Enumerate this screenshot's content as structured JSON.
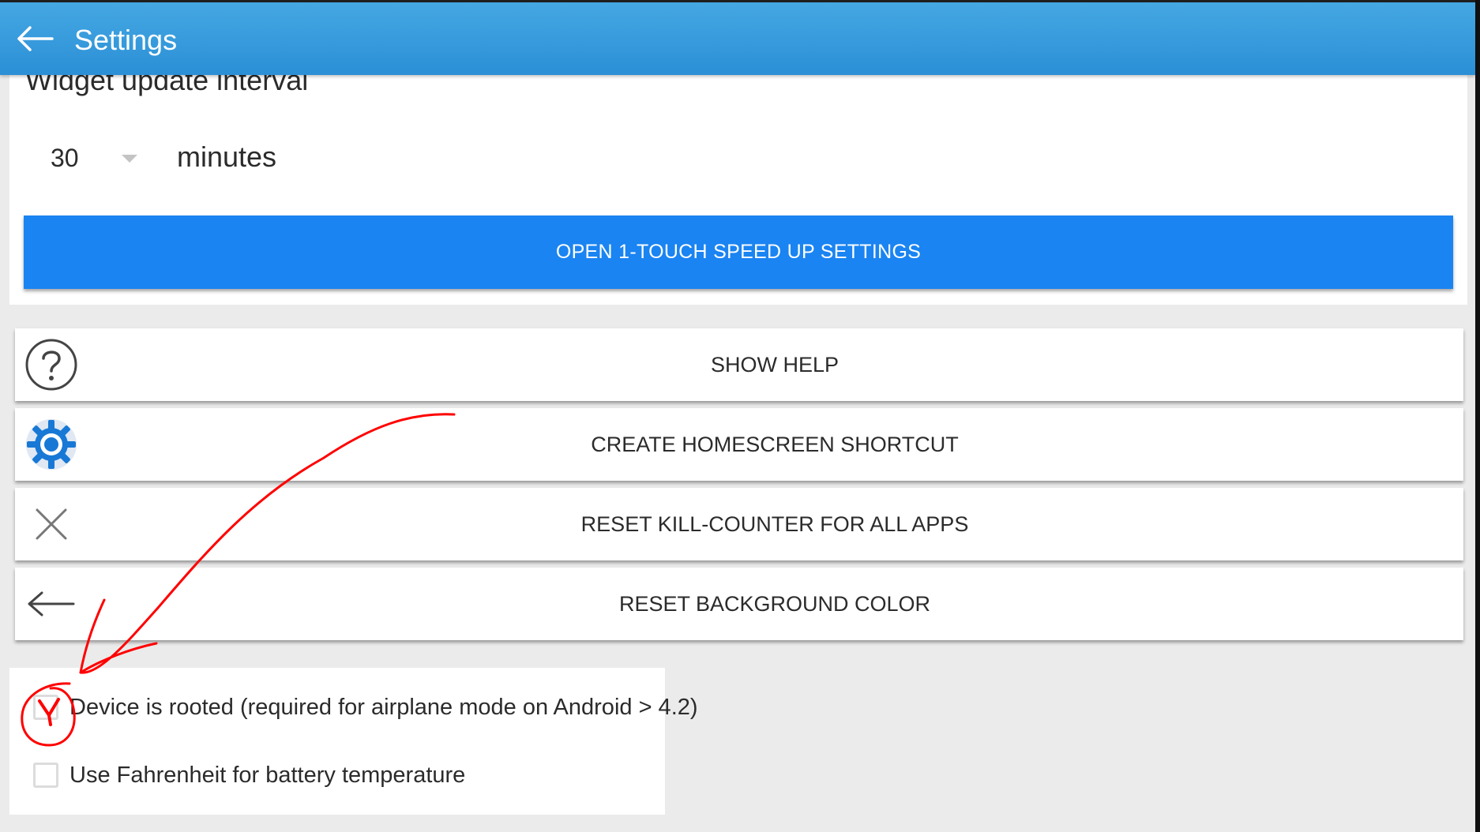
{
  "appbar": {
    "title": "Settings"
  },
  "widget": {
    "label": "Widget update interval",
    "interval_value": "30",
    "interval_unit": "minutes"
  },
  "primary_button": {
    "label": "OPEN 1-TOUCH SPEED UP SETTINGS"
  },
  "actions": [
    {
      "label": "SHOW HELP",
      "icon": "help-circle-icon"
    },
    {
      "label": "CREATE HOMESCREEN SHORTCUT",
      "icon": "gear-icon"
    },
    {
      "label": "RESET KILL-COUNTER FOR ALL APPS",
      "icon": "close-icon"
    },
    {
      "label": "RESET BACKGROUND COLOR",
      "icon": "arrow-left-icon"
    }
  ],
  "checkboxes": [
    {
      "label": "Device is rooted (required for airplane mode on Android > 4.2)",
      "checked": false
    },
    {
      "label": "Use Fahrenheit for battery temperature",
      "checked": false
    }
  ],
  "colors": {
    "appbar": "#2b8fd6",
    "primary_button": "#1a84f2",
    "annotation": "#ff0000"
  }
}
